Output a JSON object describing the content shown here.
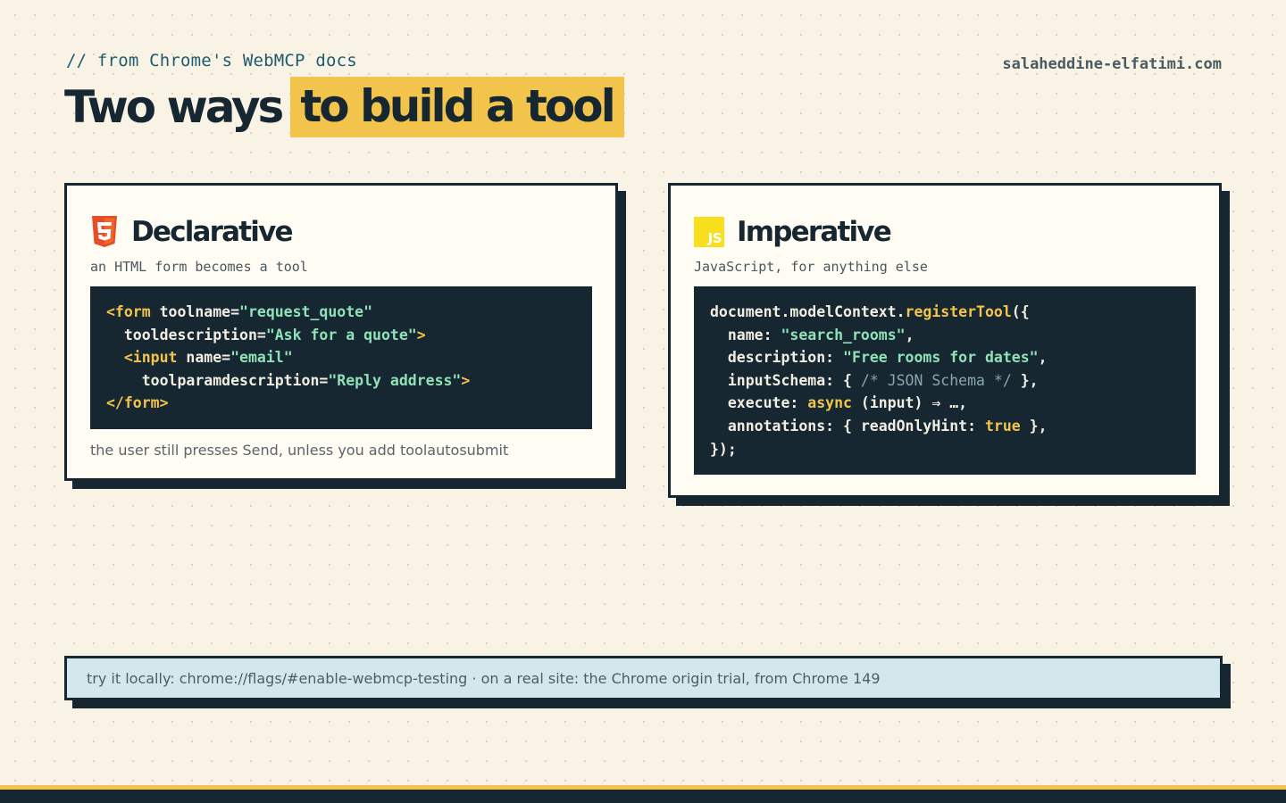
{
  "header": {
    "eyebrow": "// from Chrome's WebMCP docs",
    "site": "salaheddine-elfatimi.com",
    "title_plain": "Two ways",
    "title_highlight": "to build a tool"
  },
  "declarative": {
    "icon": "html5-icon",
    "title": "Declarative",
    "subtitle": "an HTML form becomes a tool",
    "code": {
      "l1_tag_open": "<form",
      "l1_attr": " toolname=",
      "l1_val": "\"request_quote\"",
      "l2_attr": "  tooldescription=",
      "l2_val": "\"Ask for a quote\"",
      "l2_close": ">",
      "l3_indent": "  ",
      "l3_tag": "<input",
      "l3_attr": " name=",
      "l3_val": "\"email\"",
      "l4_attr": "    toolparamdescription=",
      "l4_val": "\"Reply address\"",
      "l4_close": ">",
      "l5_tag": "</form>"
    },
    "note": "the user still presses Send, unless you add toolautosubmit"
  },
  "imperative": {
    "icon": "javascript-icon",
    "icon_text": "JS",
    "title": "Imperative",
    "subtitle": "JavaScript, for anything else",
    "code": {
      "l1_obj": "document.modelContext.",
      "l1_fn": "registerTool",
      "l1_end": "({",
      "l2_key": "  name: ",
      "l2_val": "\"search_rooms\"",
      "l2_end": ",",
      "l3_key": "  description: ",
      "l3_val": "\"Free rooms for dates\"",
      "l3_end": ",",
      "l4_key": "  inputSchema: { ",
      "l4_cmt": "/* JSON Schema */",
      "l4_end": " },",
      "l5_key": "  execute: ",
      "l5_kw": "async",
      "l5_end": " (input) ⇒ …,",
      "l6_key": "  annotations: { readOnlyHint: ",
      "l6_kw": "true",
      "l6_end": " },",
      "l7": "});"
    }
  },
  "footer": {
    "note": "try it locally: chrome://flags/#enable-webmcp-testing · on a real site: the Chrome origin trial, from Chrome 149"
  },
  "colors": {
    "background": "#f8f3e5",
    "ink": "#162731",
    "accent_yellow": "#f2c44b",
    "code_string": "#8fe1b7",
    "html5_orange": "#e44d26",
    "js_yellow": "#f7df1e",
    "footer_box": "#d3e8ec"
  }
}
